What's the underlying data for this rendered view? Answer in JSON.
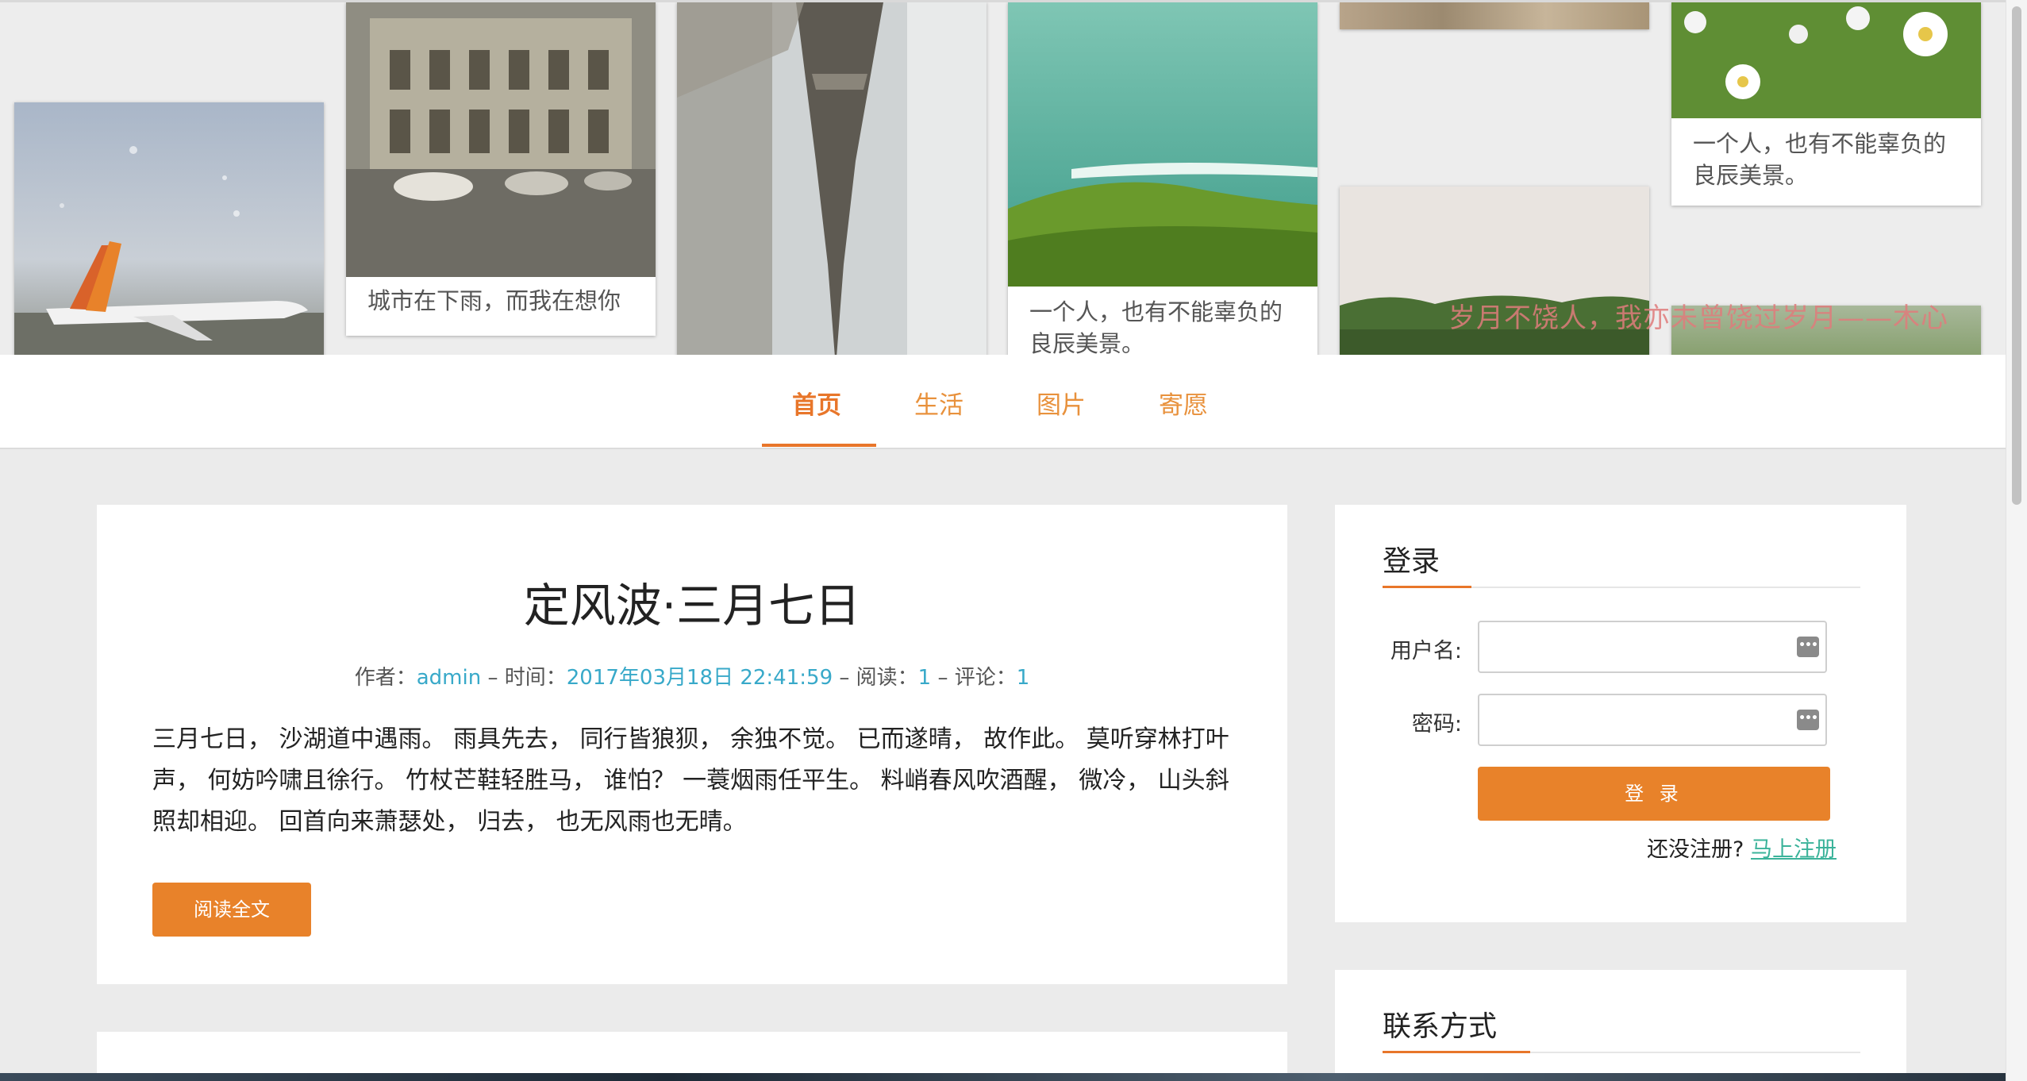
{
  "banner": {
    "captions": {
      "city_rain": "城市在下雨，而我在想你",
      "sea": "一个人，也有不能辜负的良辰美景。",
      "flower": "一个人，也有不能辜负的良辰美景。"
    },
    "slogan": "岁月不饶人，我亦未曾饶过岁月——木心"
  },
  "nav": {
    "items": [
      "首页",
      "生活",
      "图片",
      "寄愿"
    ],
    "active_index": 0
  },
  "post": {
    "title": "定风波·三月七日",
    "meta": {
      "author_label": "作者：",
      "author": "admin",
      "time_label": "时间：",
      "time": "2017年03月18日 22:41:59",
      "read_label": "阅读：",
      "reads": "1",
      "comment_label": "评论：",
      "comments": "1",
      "separator": " – "
    },
    "body": "三月七日， 沙湖道中遇雨。 雨具先去， 同行皆狼狈， 余独不觉。 已而遂晴， 故作此。 莫听穿林打叶声， 何妨吟啸且徐行。 竹杖芒鞋轻胜马， 谁怕？ 一蓑烟雨任平生。 料峭春风吹酒醒， 微冷， 山头斜照却相迎。 回首向来萧瑟处， 归去， 也无风雨也无晴。",
    "read_more": "阅读全文"
  },
  "login": {
    "title": "登录",
    "username_label": "用户名:",
    "password_label": "密码:",
    "username_value": "",
    "password_value": "",
    "key_icon": "•••",
    "submit": "登 录",
    "no_account": "还没注册?",
    "register_link": "马上注册"
  },
  "contact": {
    "title": "联系方式"
  },
  "colors": {
    "accent": "#e8822a",
    "link": "#38a9c9",
    "register": "#3bb39a",
    "background": "#ebebeb"
  }
}
